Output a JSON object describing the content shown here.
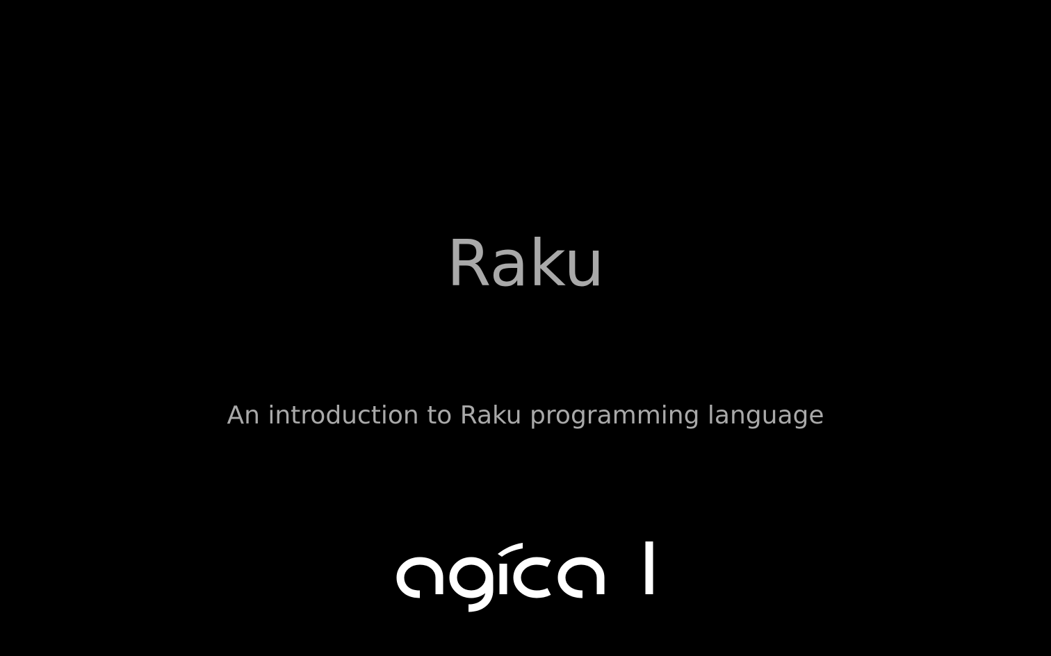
{
  "slide": {
    "title": "Raku",
    "subtitle": "An introduction to Raku programming language",
    "logo": {
      "text": "agical",
      "color": "#ffffff"
    }
  },
  "colors": {
    "background": "#000000",
    "text": "#a9a9a9"
  }
}
